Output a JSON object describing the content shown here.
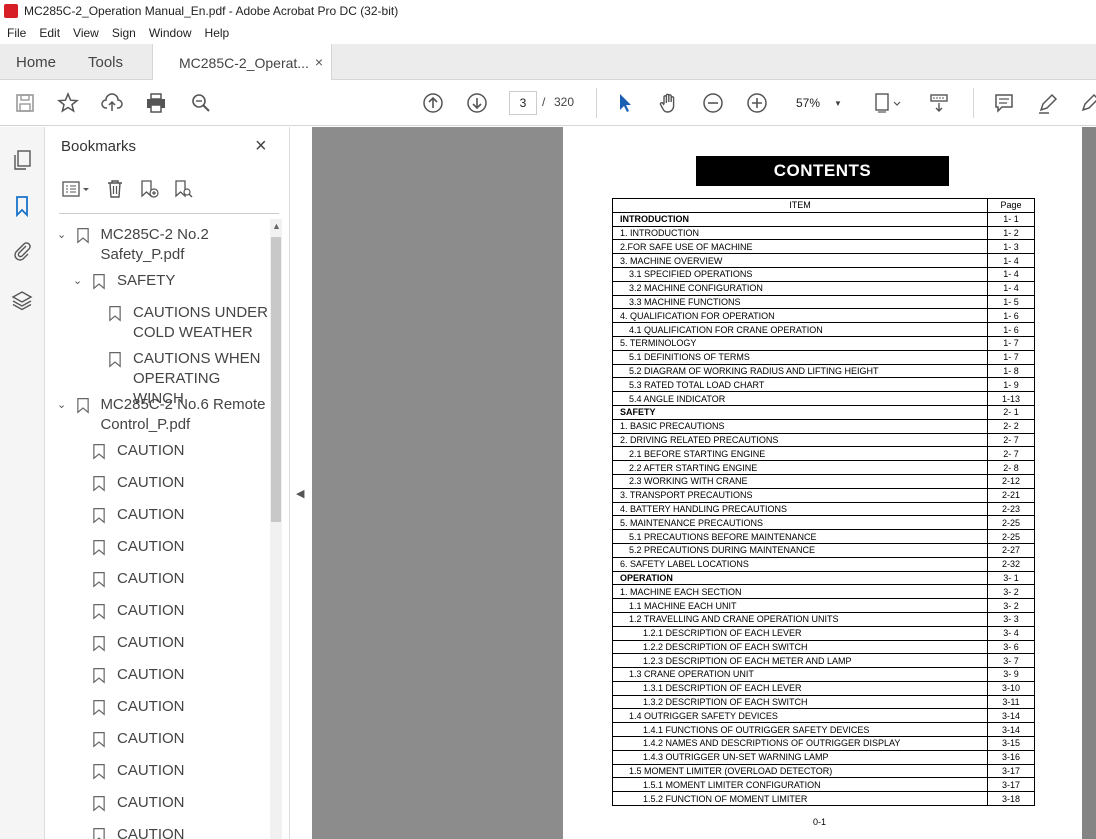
{
  "window": {
    "title": "MC285C-2_Operation Manual_En.pdf - Adobe Acrobat Pro DC (32-bit)"
  },
  "menu": [
    "File",
    "Edit",
    "View",
    "Sign",
    "Window",
    "Help"
  ],
  "tabs": {
    "home": "Home",
    "tools": "Tools",
    "document": "MC285C-2_Operat...",
    "close": "×"
  },
  "toolbar": {
    "current_page": "3",
    "page_separator": "/",
    "total_pages": "320",
    "zoom": "57%"
  },
  "bookmarks": {
    "title": "Bookmarks",
    "close": "×",
    "items": [
      {
        "label": "MC285C-2 No.2 Safety_P.pdf",
        "level": 0,
        "expanded": true
      },
      {
        "label": "SAFETY",
        "level": 1,
        "expanded": true
      },
      {
        "label": "CAUTIONS UNDER COLD WEATHER",
        "level": 2
      },
      {
        "label": "CAUTIONS WHEN OPERATING WINCH",
        "level": 2
      },
      {
        "label": "MC285C-2 No.6 Remote Control_P.pdf",
        "level": 0,
        "expanded": true
      },
      {
        "label": "CAUTION",
        "level": 1
      },
      {
        "label": "CAUTION",
        "level": 1
      },
      {
        "label": "CAUTION",
        "level": 1
      },
      {
        "label": "CAUTION",
        "level": 1
      },
      {
        "label": "CAUTION",
        "level": 1
      },
      {
        "label": "CAUTION",
        "level": 1
      },
      {
        "label": "CAUTION",
        "level": 1
      },
      {
        "label": "CAUTION",
        "level": 1
      },
      {
        "label": "CAUTION",
        "level": 1
      },
      {
        "label": "CAUTION",
        "level": 1
      },
      {
        "label": "CAUTION",
        "level": 1
      },
      {
        "label": "CAUTION",
        "level": 1
      },
      {
        "label": "CAUTION",
        "level": 1
      }
    ]
  },
  "document": {
    "heading": "CONTENTS",
    "col_item": "ITEM",
    "col_page": "Page",
    "footer": "0-1",
    "rows": [
      {
        "item": "INTRODUCTION",
        "page": "1- 1",
        "level": 0,
        "bold": true
      },
      {
        "item": "1. INTRODUCTION",
        "page": "1- 2",
        "level": 0
      },
      {
        "item": "2.FOR SAFE USE OF MACHINE",
        "page": "1- 3",
        "level": 0
      },
      {
        "item": "3. MACHINE OVERVIEW",
        "page": "1- 4",
        "level": 0
      },
      {
        "item": "3.1 SPECIFIED OPERATIONS",
        "page": "1- 4",
        "level": 1
      },
      {
        "item": "3.2 MACHINE CONFIGURATION",
        "page": "1- 4",
        "level": 1
      },
      {
        "item": "3.3 MACHINE FUNCTIONS",
        "page": "1- 5",
        "level": 1
      },
      {
        "item": "4. QUALIFICATION FOR OPERATION",
        "page": "1- 6",
        "level": 0
      },
      {
        "item": "4.1 QUALIFICATION FOR CRANE OPERATION",
        "page": "1- 6",
        "level": 1
      },
      {
        "item": "5. TERMINOLOGY",
        "page": "1- 7",
        "level": 0
      },
      {
        "item": "5.1 DEFINITIONS OF TERMS",
        "page": "1- 7",
        "level": 1
      },
      {
        "item": "5.2 DIAGRAM OF WORKING RADIUS AND LIFTING HEIGHT",
        "page": "1- 8",
        "level": 1
      },
      {
        "item": "5.3 RATED TOTAL LOAD CHART",
        "page": "1- 9",
        "level": 1
      },
      {
        "item": "5.4 ANGLE INDICATOR",
        "page": "1-13",
        "level": 1
      },
      {
        "item": "SAFETY",
        "page": "2- 1",
        "level": 0,
        "bold": true
      },
      {
        "item": "1. BASIC PRECAUTIONS",
        "page": "2- 2",
        "level": 0
      },
      {
        "item": "2. DRIVING RELATED PRECAUTIONS",
        "page": "2- 7",
        "level": 0
      },
      {
        "item": "2.1 BEFORE STARTING ENGINE",
        "page": "2- 7",
        "level": 1
      },
      {
        "item": "2.2 AFTER STARTING ENGINE",
        "page": "2- 8",
        "level": 1
      },
      {
        "item": "2.3 WORKING WITH CRANE",
        "page": "2-12",
        "level": 1
      },
      {
        "item": "3. TRANSPORT PRECAUTIONS",
        "page": "2-21",
        "level": 0
      },
      {
        "item": "4. BATTERY HANDLING PRECAUTIONS",
        "page": "2-23",
        "level": 0
      },
      {
        "item": "5. MAINTENANCE PRECAUTIONS",
        "page": "2-25",
        "level": 0
      },
      {
        "item": "5.1 PRECAUTIONS BEFORE MAINTENANCE",
        "page": "2-25",
        "level": 1
      },
      {
        "item": "5.2 PRECAUTIONS DURING MAINTENANCE",
        "page": "2-27",
        "level": 1
      },
      {
        "item": "6. SAFETY LABEL LOCATIONS",
        "page": "2-32",
        "level": 0
      },
      {
        "item": "OPERATION",
        "page": "3- 1",
        "level": 0,
        "bold": true
      },
      {
        "item": "1. MACHINE EACH SECTION",
        "page": "3- 2",
        "level": 0
      },
      {
        "item": "1.1 MACHINE EACH UNIT",
        "page": "3- 2",
        "level": 1
      },
      {
        "item": "1.2 TRAVELLING AND CRANE OPERATION UNITS",
        "page": "3- 3",
        "level": 1
      },
      {
        "item": "1.2.1 DESCRIPTION OF EACH LEVER",
        "page": "3- 4",
        "level": 2
      },
      {
        "item": "1.2.2 DESCRIPTION  OF EACH SWITCH",
        "page": "3- 6",
        "level": 2
      },
      {
        "item": "1.2.3 DESCRIPTION OF EACH METER AND LAMP",
        "page": "3- 7",
        "level": 2
      },
      {
        "item": "1.3 CRANE OPERATION UNIT",
        "page": "3- 9",
        "level": 1
      },
      {
        "item": "1.3.1 DESCRIPTION OF EACH LEVER",
        "page": "3-10",
        "level": 2
      },
      {
        "item": "1.3.2 DESCRIPTION  OF EACH SWITCH",
        "page": "3-11",
        "level": 2
      },
      {
        "item": "1.4 OUTRIGGER SAFETY DEVICES",
        "page": "3-14",
        "level": 1
      },
      {
        "item": "1.4.1 FUNCTIONS OF OUTRIGGER SAFETY DEVICES",
        "page": "3-14",
        "level": 2
      },
      {
        "item": "1.4.2 NAMES AND DESCRIPTIONS OF OUTRIGGER DISPLAY",
        "page": "3-15",
        "level": 2
      },
      {
        "item": "1.4.3 OUTRIGGER UN-SET WARNING LAMP",
        "page": "3-16",
        "level": 2
      },
      {
        "item": "1.5 MOMENT LIMITER (OVERLOAD DETECTOR)",
        "page": "3-17",
        "level": 1
      },
      {
        "item": "1.5.1 MOMENT LIMITER CONFIGURATION",
        "page": "3-17",
        "level": 2
      },
      {
        "item": "1.5.2 FUNCTION OF MOMENT LIMITER",
        "page": "3-18",
        "level": 2
      }
    ]
  }
}
